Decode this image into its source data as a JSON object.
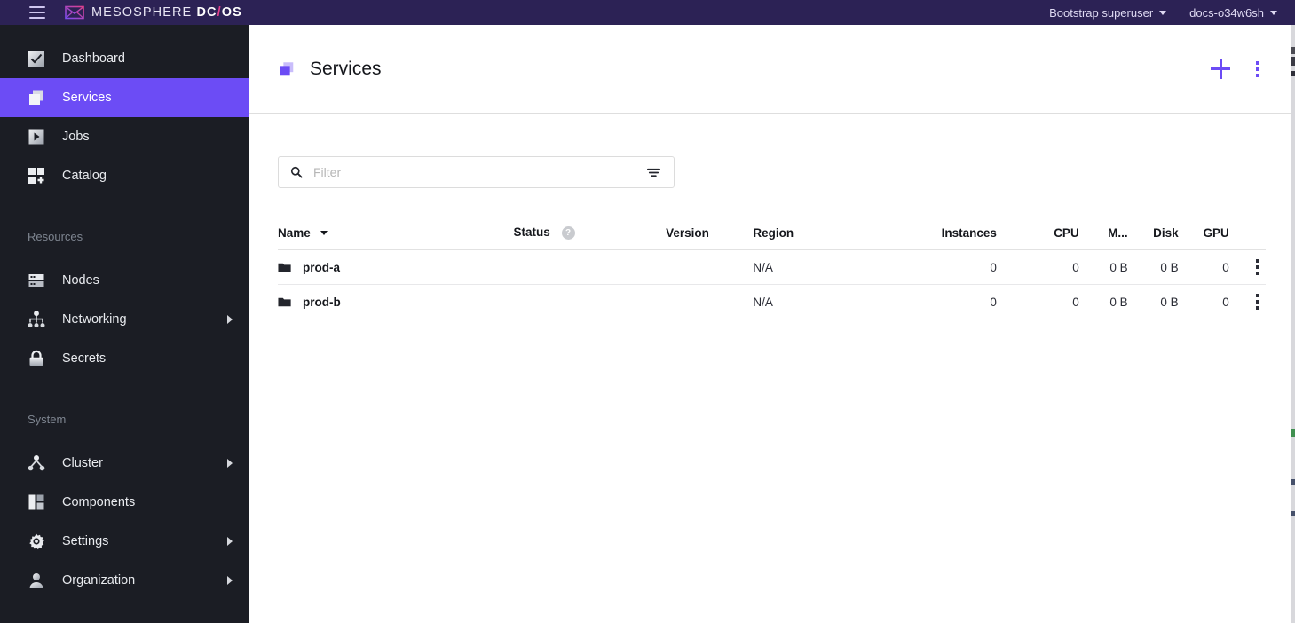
{
  "topbar": {
    "menu_icon": "hamburger-icon",
    "brand_prefix": "MESOSPHERE",
    "brand_dc": "DC",
    "brand_slash": "/",
    "brand_os": "OS",
    "user_menu": "Bootstrap superuser",
    "cluster_menu": "docs-o34w6sh"
  },
  "sidebar": {
    "primary": [
      {
        "label": "Dashboard",
        "icon": "dashboard-icon",
        "active": false,
        "expandable": false
      },
      {
        "label": "Services",
        "icon": "services-icon",
        "active": true,
        "expandable": false
      },
      {
        "label": "Jobs",
        "icon": "jobs-icon",
        "active": false,
        "expandable": false
      },
      {
        "label": "Catalog",
        "icon": "catalog-icon",
        "active": false,
        "expandable": false
      }
    ],
    "resources_header": "Resources",
    "resources": [
      {
        "label": "Nodes",
        "icon": "nodes-icon",
        "expandable": false
      },
      {
        "label": "Networking",
        "icon": "networking-icon",
        "expandable": true
      },
      {
        "label": "Secrets",
        "icon": "secrets-icon",
        "expandable": false
      }
    ],
    "system_header": "System",
    "system": [
      {
        "label": "Cluster",
        "icon": "cluster-icon",
        "expandable": true
      },
      {
        "label": "Components",
        "icon": "components-icon",
        "expandable": false
      },
      {
        "label": "Settings",
        "icon": "settings-gear-icon",
        "expandable": true
      },
      {
        "label": "Organization",
        "icon": "organization-icon",
        "expandable": true
      }
    ]
  },
  "page": {
    "title": "Services",
    "title_icon": "services-icon",
    "add_button": "add-icon",
    "more_button": "more-vertical-icon"
  },
  "filter": {
    "placeholder": "Filter",
    "value": "",
    "search_icon": "search-icon",
    "filter_icon": "filter-lines-icon"
  },
  "table": {
    "columns": [
      {
        "key": "name",
        "label": "Name",
        "sorted": true,
        "sort_direction": "desc"
      },
      {
        "key": "status",
        "label": "Status",
        "has_help": true,
        "help_glyph": "?"
      },
      {
        "key": "version",
        "label": "Version"
      },
      {
        "key": "region",
        "label": "Region"
      },
      {
        "key": "instances",
        "label": "Instances"
      },
      {
        "key": "cpu",
        "label": "CPU"
      },
      {
        "key": "mem",
        "label": "M..."
      },
      {
        "key": "disk",
        "label": "Disk"
      },
      {
        "key": "gpu",
        "label": "GPU"
      }
    ],
    "rows": [
      {
        "name": "prod-a",
        "icon": "folder-icon",
        "status": "",
        "version": "",
        "region": "N/A",
        "instances": "0",
        "cpu": "0",
        "mem": "0 B",
        "disk": "0 B",
        "gpu": "0",
        "menu": "more-vertical-icon"
      },
      {
        "name": "prod-b",
        "icon": "folder-icon",
        "status": "",
        "version": "",
        "region": "N/A",
        "instances": "0",
        "cpu": "0",
        "mem": "0 B",
        "disk": "0 B",
        "gpu": "0",
        "menu": "more-vertical-icon"
      }
    ]
  },
  "colors": {
    "topbar_bg": "#2c2255",
    "sidebar_bg": "#1b1d24",
    "accent_purple": "#6c4cf5",
    "brand_pink": "#e0408c",
    "content_bg": "#ffffff"
  }
}
